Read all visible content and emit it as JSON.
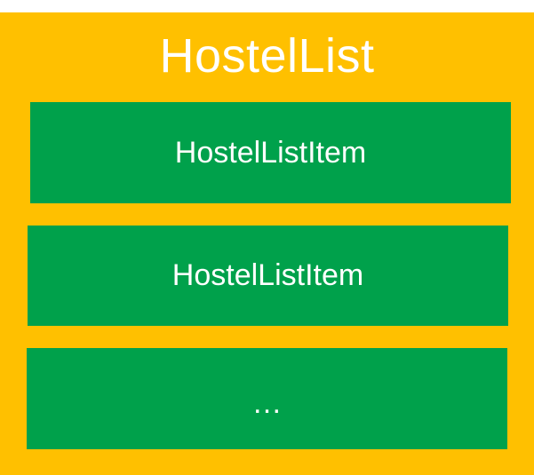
{
  "container": {
    "title": "HostelList",
    "items": [
      {
        "label": "HostelListItem"
      },
      {
        "label": "HostelListItem"
      },
      {
        "label": "…"
      }
    ]
  },
  "colors": {
    "container_fill": "#ffc000",
    "item_fill": "#00a14b",
    "text": "#ffffff"
  }
}
